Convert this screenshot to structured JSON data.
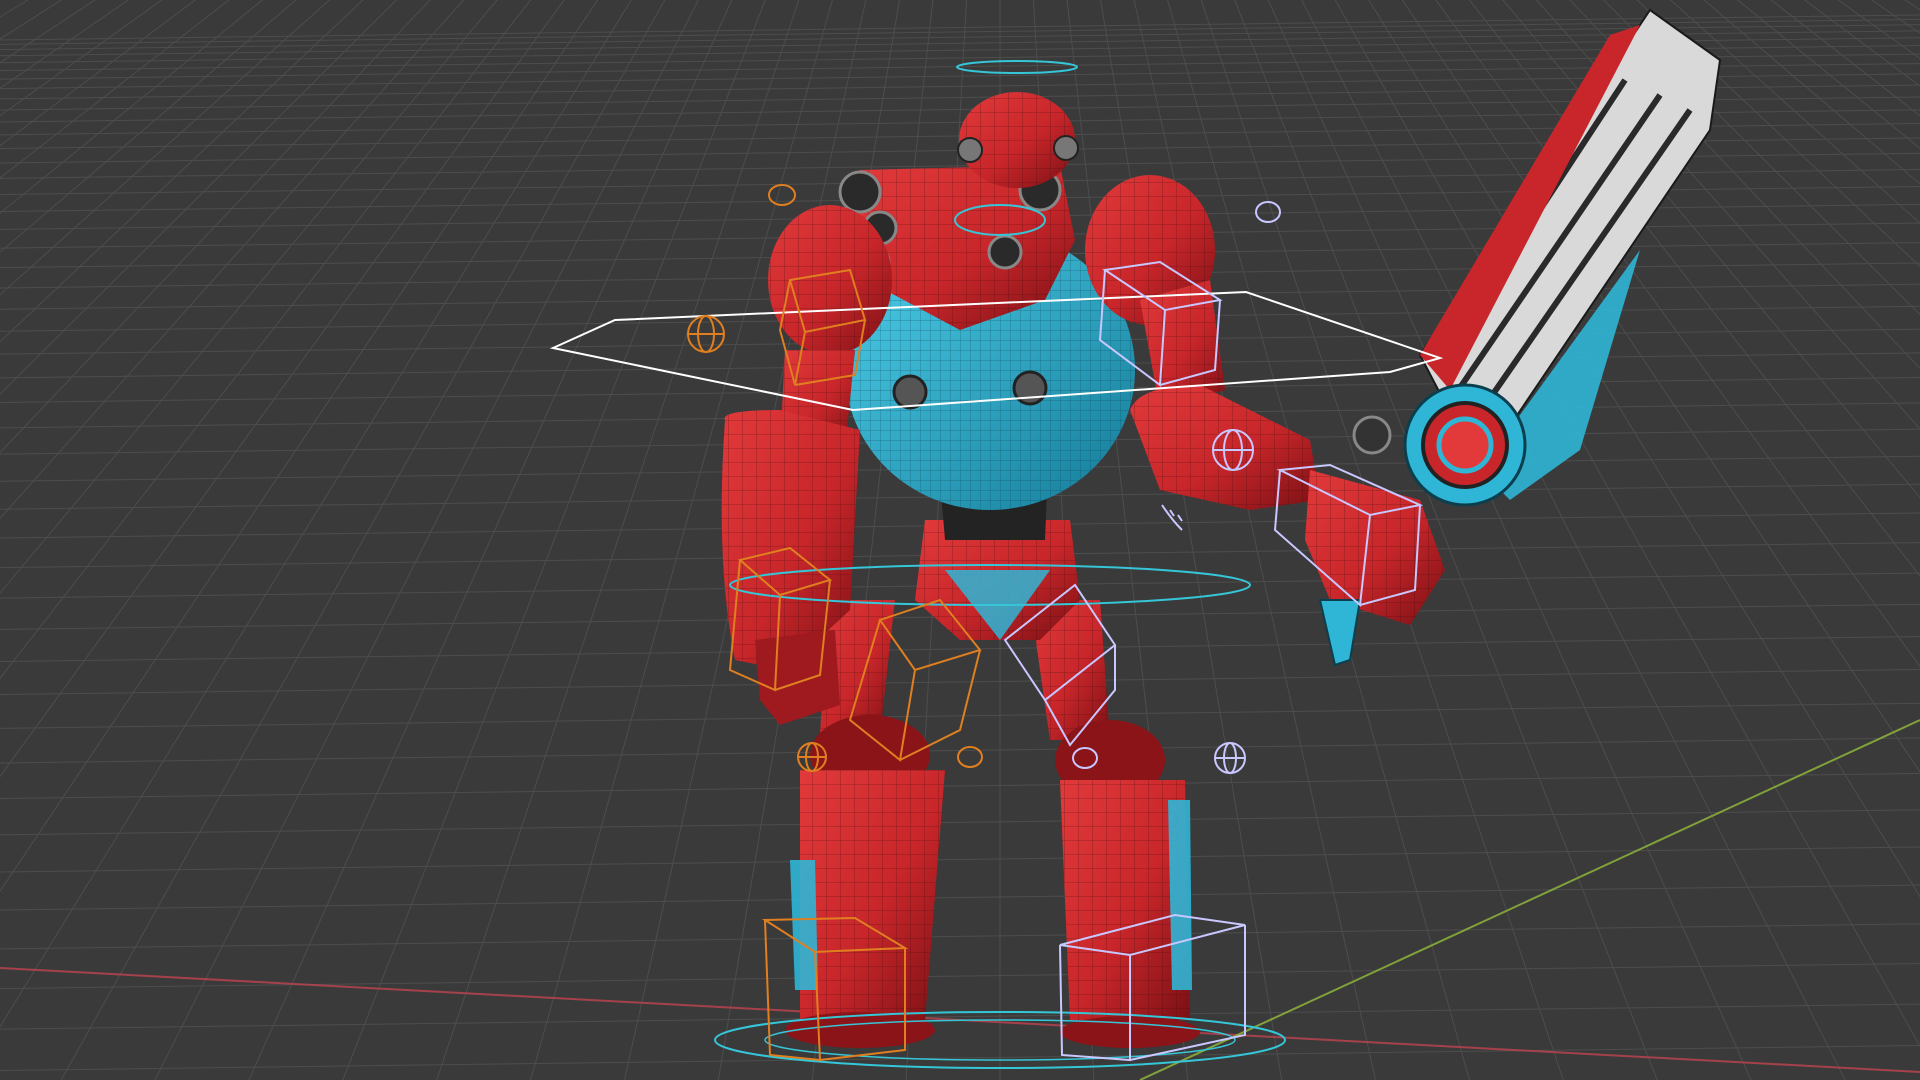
{
  "viewport": {
    "background": "#3a3a3a",
    "grid_color": "#4d4d4d",
    "axis_x_color": "#b8434f",
    "axis_y_color": "#8fb43a"
  },
  "model": {
    "armor_color": "#c8262a",
    "armor_dark": "#7a1014",
    "core_color": "#2fb6d6",
    "core_dark": "#137a97",
    "metal_color": "#2a2a2a",
    "blade_color": "#d9d9d9",
    "blade_stripe": "#2a2a2a"
  },
  "rig": {
    "ik_control_color": "#e07f20",
    "fk_control_color": "#c9c7ff",
    "root_control_color": "#35c6d8",
    "selection_color": "#ffffff"
  },
  "icons": [
    "wire-sphere-icon",
    "wire-cube-icon",
    "ring-control-icon",
    "circle-control-icon"
  ]
}
